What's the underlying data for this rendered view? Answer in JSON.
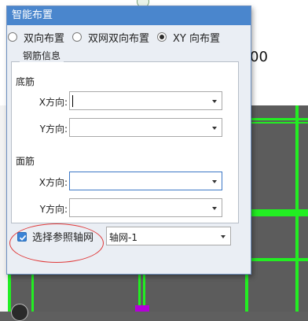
{
  "background": {
    "dimension_text": "00"
  },
  "dialog": {
    "title": "智能布置",
    "modes": [
      {
        "label": "双向布置",
        "selected": false
      },
      {
        "label": "双网双向布置",
        "selected": false
      },
      {
        "label": "XY 向布置",
        "selected": true
      }
    ],
    "group_title": "钢筋信息",
    "bottom_section": {
      "title": "底筋",
      "x_label": "X方向:",
      "x_value": "",
      "y_label": "Y方向:",
      "y_value": ""
    },
    "top_section": {
      "title": "面筋",
      "x_label": "X方向:",
      "x_value": "",
      "y_label": "Y方向:",
      "y_value": ""
    },
    "reference_grid": {
      "checkbox_label": "选择参照轴网",
      "checked": true,
      "selected": "轴网-1"
    }
  },
  "colors": {
    "title_bar": "#4a86cd",
    "grid_lines": "#22ee22",
    "annotation": "#e03a3a"
  }
}
